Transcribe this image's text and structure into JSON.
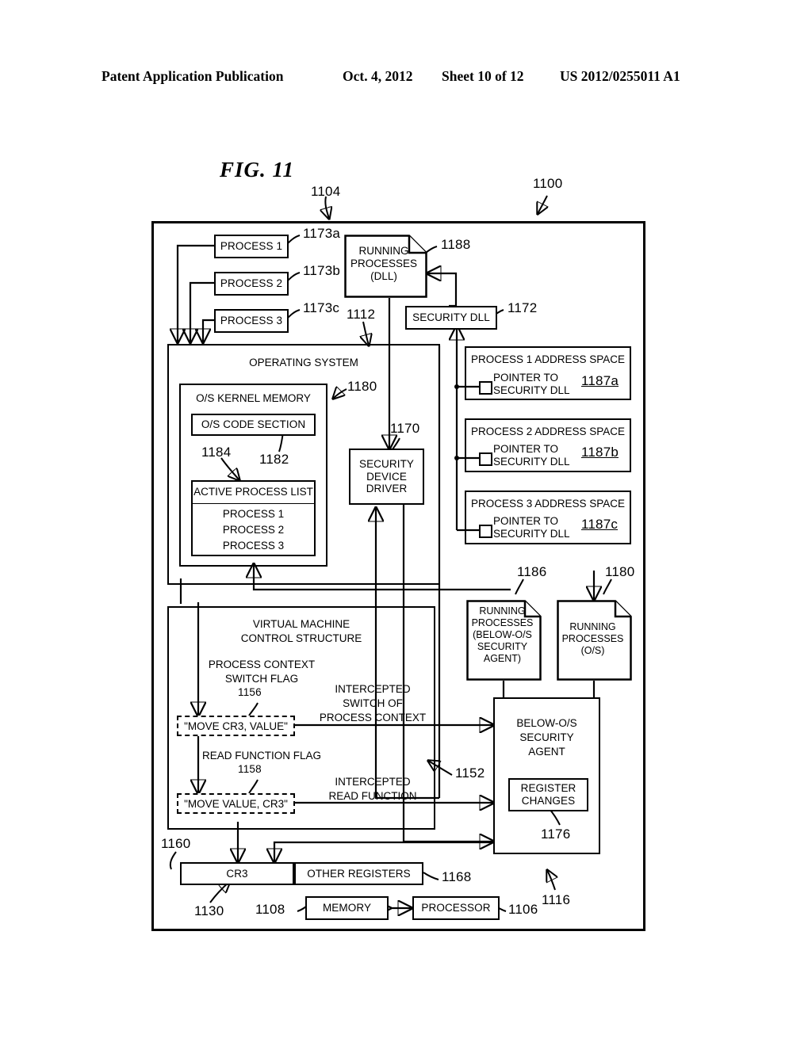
{
  "header": {
    "publication": "Patent Application Publication",
    "date": "Oct. 4, 2012",
    "sheet": "Sheet 10 of 12",
    "number": "US 2012/0255011 A1"
  },
  "figure": {
    "title": "FIG. 11",
    "system_ref": "1100",
    "os_ref": "1104"
  },
  "refs": {
    "r1100": "1100",
    "r1104": "1104",
    "r1106": "1106",
    "r1108": "1108",
    "r1112": "1112",
    "r1116": "1116",
    "r1130": "1130",
    "r1152": "1152",
    "r1156": "1156",
    "r1158": "1158",
    "r1160": "1160",
    "r1168": "1168",
    "r1170": "1170",
    "r1172": "1172",
    "r1173a": "1173a",
    "r1173b": "1173b",
    "r1173c": "1173c",
    "r1176": "1176",
    "r1180a": "1180",
    "r1180b": "1180",
    "r1182": "1182",
    "r1184": "1184",
    "r1186": "1186",
    "r1187a": "1187a",
    "r1187b": "1187b",
    "r1187c": "1187c",
    "r1188": "1188"
  },
  "blocks": {
    "process1": "PROCESS 1",
    "process2": "PROCESS 2",
    "process3": "PROCESS 3",
    "running_processes_dll_l1": "RUNNING",
    "running_processes_dll_l2": "PROCESSES",
    "running_processes_dll_l3": "(DLL)",
    "security_dll": "SECURITY DLL",
    "operating_system": "OPERATING SYSTEM",
    "os_kernel_memory": "O/S KERNEL MEMORY",
    "os_code_section": "O/S CODE SECTION",
    "active_process_list": "ACTIVE PROCESS LIST",
    "apl_item1": "PROCESS 1",
    "apl_item2": "PROCESS 2",
    "apl_item3": "PROCESS 3",
    "security_device_driver_l1": "SECURITY",
    "security_device_driver_l2": "DEVICE",
    "security_device_driver_l3": "DRIVER",
    "proc1_addr_space": "PROCESS 1 ADDRESS SPACE",
    "proc2_addr_space": "PROCESS 2 ADDRESS SPACE",
    "proc3_addr_space": "PROCESS 3 ADDRESS SPACE",
    "pointer_l1": "POINTER TO",
    "pointer_l2": "SECURITY DLL",
    "rp_below_l1": "RUNNING",
    "rp_below_l2": "PROCESSES",
    "rp_below_l3": "(BELOW-O/S",
    "rp_below_l4": "SECURITY",
    "rp_below_l5": "AGENT)",
    "rp_os_l1": "RUNNING",
    "rp_os_l2": "PROCESSES",
    "rp_os_l3": "(O/S)",
    "vmcs_l1": "VIRTUAL MACHINE",
    "vmcs_l2": "CONTROL STRUCTURE",
    "pcsf_l1": "PROCESS  CONTEXT",
    "pcsf_l2": "SWITCH FLAG",
    "move_cr3_value": "\"MOVE CR3, VALUE\"",
    "read_function_flag": "READ FUNCTION FLAG",
    "move_value_cr3": "\"MOVE VALUE, CR3\"",
    "intercepted_switch_l1": "INTERCEPTED",
    "intercepted_switch_l2": "SWITCH OF",
    "intercepted_switch_l3": "PROCESS CONTEXT",
    "intercepted_read_l1": "INTERCEPTED",
    "intercepted_read_l2": "READ FUNCTION",
    "below_os_agent_l1": "BELOW-O/S",
    "below_os_agent_l2": "SECURITY",
    "below_os_agent_l3": "AGENT",
    "register_changes_l1": "REGISTER",
    "register_changes_l2": "CHANGES",
    "cr3": "CR3",
    "other_registers": "OTHER REGISTERS",
    "memory": "MEMORY",
    "processor": "PROCESSOR"
  }
}
